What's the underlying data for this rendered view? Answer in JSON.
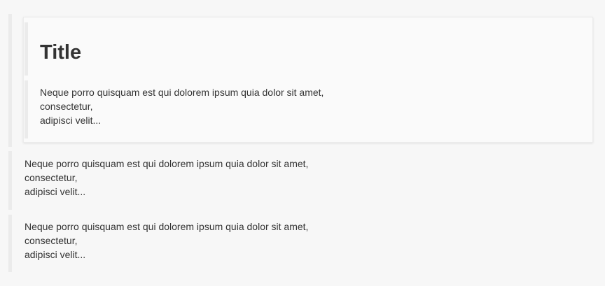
{
  "card": {
    "title": "Title",
    "body": [
      "Neque porro quisquam est qui dolorem ipsum quia dolor sit amet,",
      "consectetur,",
      "adipisci velit..."
    ]
  },
  "blocks": [
    {
      "lines": [
        "Neque porro quisquam est qui dolorem ipsum quia dolor sit amet,",
        "consectetur,",
        "adipisci velit..."
      ]
    },
    {
      "lines": [
        "Neque porro quisquam est qui dolorem ipsum quia dolor sit amet,",
        "consectetur,",
        "adipisci velit..."
      ]
    }
  ]
}
